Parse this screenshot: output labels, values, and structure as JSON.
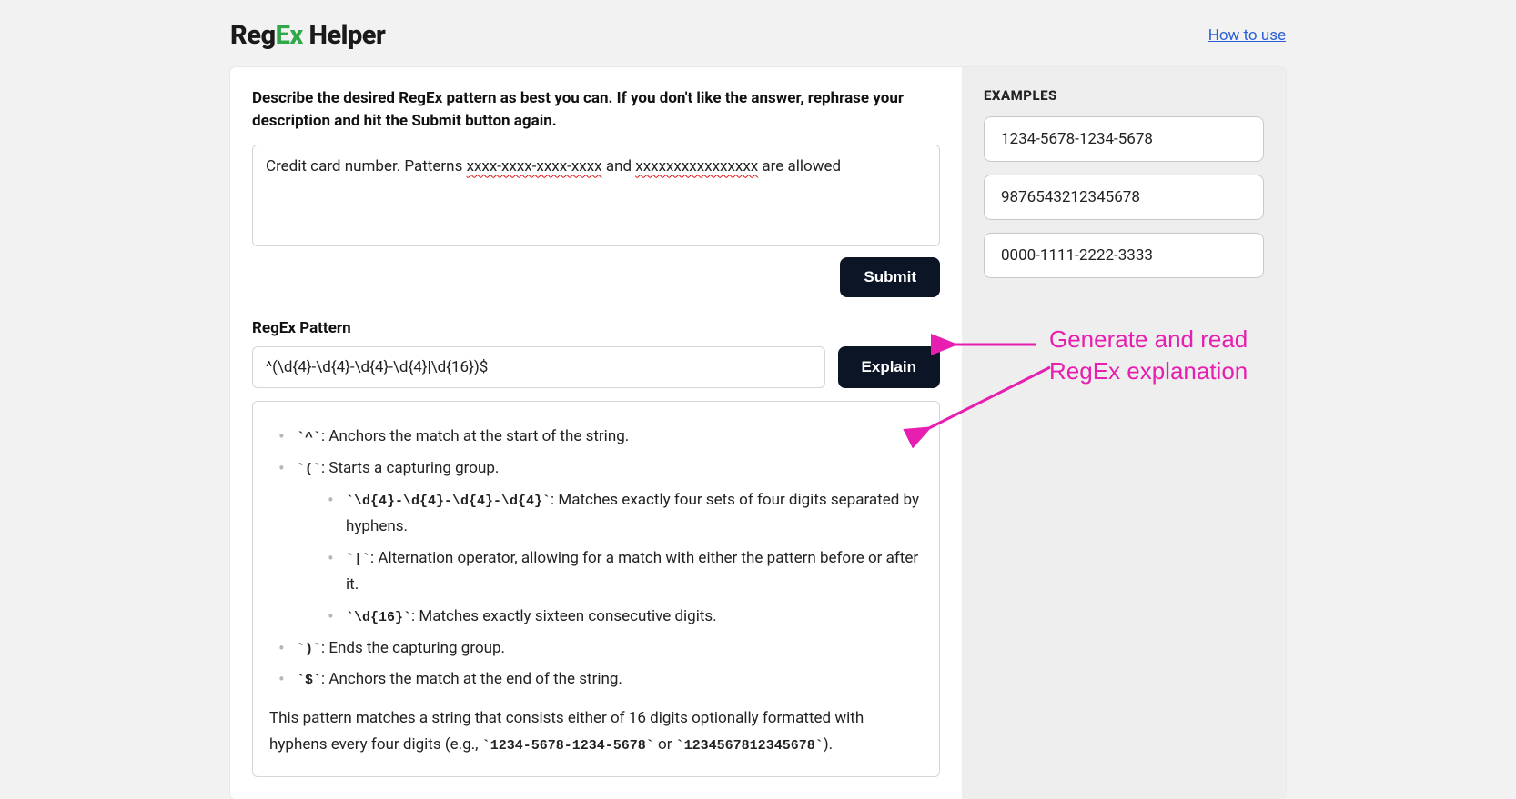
{
  "header": {
    "logo_reg": "Reg",
    "logo_ex": "Ex",
    "logo_helper": " Helper",
    "howto": "How to use"
  },
  "main": {
    "instruction": "Describe the desired RegEx pattern as best you can. If you don't like the answer, rephrase your description and hit the Submit button again.",
    "description_prefix": "Credit card number. Patterns ",
    "description_pattern1": "xxxx-xxxx-xxxx-xxxx",
    "description_mid": " and ",
    "description_pattern2": "xxxxxxxxxxxxxxxx",
    "description_suffix": " are allowed",
    "submit_label": "Submit",
    "pattern_label": "RegEx Pattern",
    "pattern_value": "^(\\d{4}-\\d{4}-\\d{4}-\\d{4}|\\d{16})$",
    "explain_label": "Explain"
  },
  "explain": {
    "b1_code": "`^`",
    "b1_text": ": Anchors the match at the start of the string.",
    "b2_code": "`(`",
    "b2_text": ": Starts a capturing group.",
    "b2a_code": "`\\d{4}-\\d{4}-\\d{4}-\\d{4}`",
    "b2a_text": ": Matches exactly four sets of four digits separated by hyphens.",
    "b2b_code": "`|`",
    "b2b_text": ": Alternation operator, allowing for a match with either the pattern before or after it.",
    "b2c_code": "`\\d{16}`",
    "b2c_text": ": Matches exactly sixteen consecutive digits.",
    "b3_code": "`)`",
    "b3_text": ": Ends the capturing group.",
    "b4_code": "`$`",
    "b4_text": ": Anchors the match at the end of the string.",
    "summary_pre": "This pattern matches a string that consists either of 16 digits optionally formatted with hyphens every four digits (e.g., ",
    "summary_ex1": "`1234-5678-1234-5678`",
    "summary_or": " or ",
    "summary_ex2": "`1234567812345678`",
    "summary_post": ")."
  },
  "examples": {
    "title": "EXAMPLES",
    "items": [
      "1234-5678-1234-5678",
      "9876543212345678",
      "0000-1111-2222-3333"
    ]
  },
  "annotation": {
    "text": "Generate and read RegEx explanation"
  }
}
